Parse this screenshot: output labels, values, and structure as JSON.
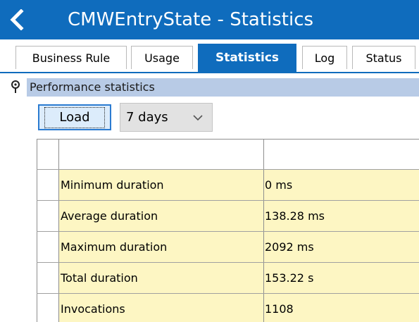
{
  "window": {
    "title": "CMWEntryState - Statistics"
  },
  "tabs": [
    {
      "label": "Business Rule",
      "active": false
    },
    {
      "label": "Usage",
      "active": false
    },
    {
      "label": "Statistics",
      "active": true
    },
    {
      "label": "Log",
      "active": false
    },
    {
      "label": "Status",
      "active": false
    }
  ],
  "section": {
    "title": "Performance statistics"
  },
  "toolbar": {
    "load_label": "Load",
    "period_value": "7 days"
  },
  "table": {
    "columns": [
      "",
      ""
    ],
    "rows": [
      {
        "name": "Minimum duration",
        "value": "0 ms"
      },
      {
        "name": "Average duration",
        "value": "138.28 ms"
      },
      {
        "name": "Maximum duration",
        "value": "2092 ms"
      },
      {
        "name": "Total duration",
        "value": "153.22 s"
      },
      {
        "name": "Invocations",
        "value": "1108"
      }
    ]
  },
  "colors": {
    "accent": "#0f6cbd",
    "section_bar": "#b8cbe6",
    "cell_highlight": "#fdf6c3"
  }
}
